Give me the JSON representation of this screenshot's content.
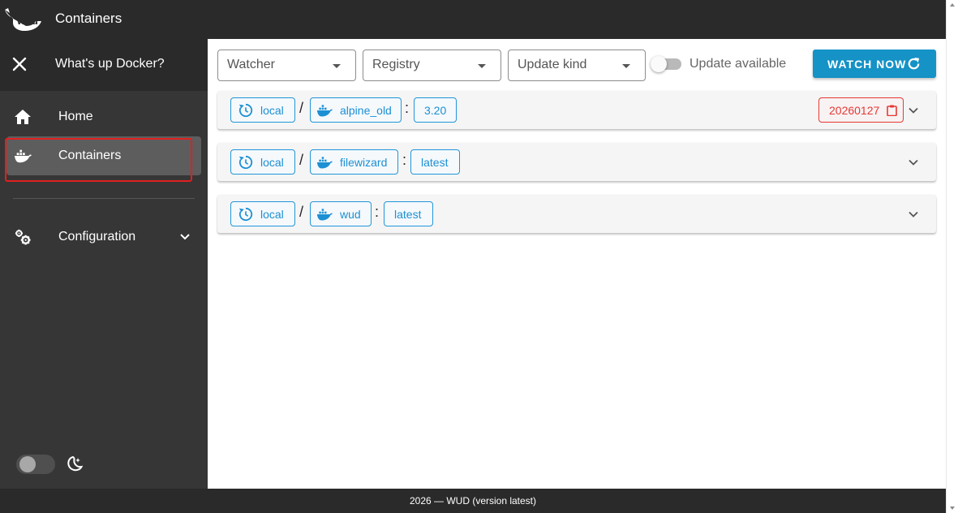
{
  "appbar": {
    "title": "Containers"
  },
  "drawer": {
    "title": "What's up Docker?"
  },
  "nav": {
    "home": "Home",
    "containers": "Containers",
    "configuration": "Configuration"
  },
  "filters": {
    "watcher": "Watcher",
    "registry": "Registry",
    "update_kind": "Update kind",
    "update_available": "Update available"
  },
  "watch_button": "WATCH NOW",
  "containers": [
    {
      "watcher": "local",
      "name": "alpine_old",
      "tag": "3.20",
      "update": "20260127"
    },
    {
      "watcher": "local",
      "name": "filewizard",
      "tag": "latest"
    },
    {
      "watcher": "local",
      "name": "wud",
      "tag": "latest"
    }
  ],
  "footer": "2026 — WUD (version latest)",
  "colors": {
    "primary": "#1592c6",
    "chip_blue": "#2196d8",
    "update_red": "#e53935",
    "sidebar_bg": "#363636",
    "appbar_bg": "#2a2a2a"
  }
}
